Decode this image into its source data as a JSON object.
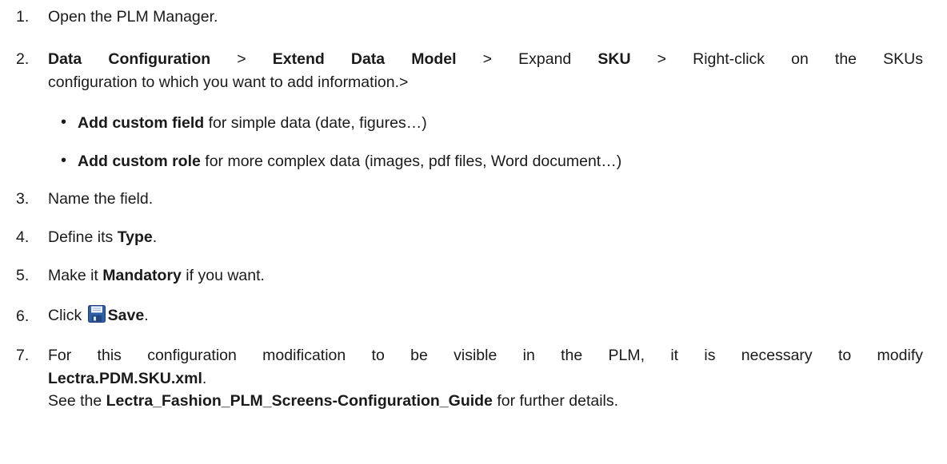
{
  "steps": [
    {
      "num": "1.",
      "text": "Open the PLM Manager."
    },
    {
      "num": "2.",
      "b1": "Data Configuration",
      "sep1": " > ",
      "b2": "Extend Data Model",
      "mid": " > Expand ",
      "b3": "SKU",
      "rest": " > Right-click on the SKUs",
      "line2": "configuration to which you want to add information.>"
    },
    {
      "num": "3.",
      "text": "Name the field."
    },
    {
      "num": "4.",
      "pre": "Define its ",
      "bold": "Type",
      "post": "."
    },
    {
      "num": "5.",
      "pre": "Make it ",
      "bold": "Mandatory",
      "post": " if you want."
    },
    {
      "num": "6.",
      "pre": "Click ",
      "bold": "Save",
      "post": "."
    },
    {
      "num": "7.",
      "line1": "For this configuration modification to be visible in the PLM, it is necessary to modify",
      "bold_file": "Lectra.PDM.SKU.xml",
      "file_post": ".",
      "see_pre": "See the ",
      "bold_guide": "Lectra_Fashion_PLM_Screens-Configuration_Guide",
      "see_post": " for further details."
    }
  ],
  "bullets": [
    {
      "symbol": "•",
      "bold": "Add custom field",
      "text": " for simple data (date, figures…)"
    },
    {
      "symbol": "•",
      "bold": "Add custom role",
      "text": " for more complex data (images, pdf files, Word document…)"
    }
  ],
  "icons": {
    "save": "floppy-disk-icon"
  },
  "colors": {
    "text": "#1a1a1a",
    "icon_blue": "#2c5fa8"
  }
}
